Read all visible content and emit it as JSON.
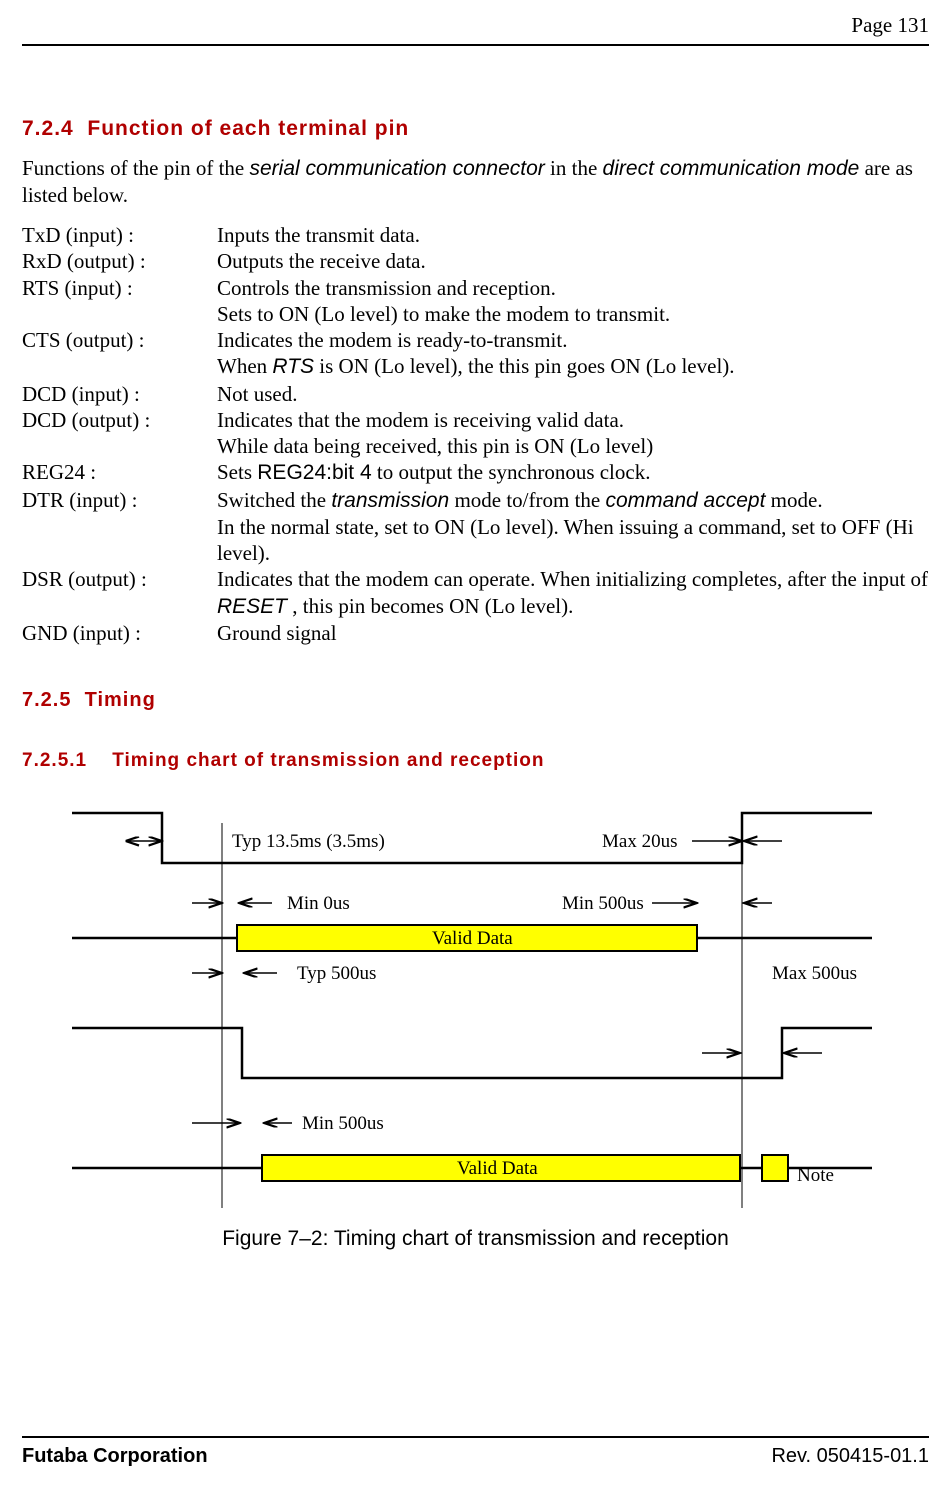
{
  "header": {
    "page_label": "Page  131"
  },
  "h724": {
    "num": "7.2.4",
    "title": "Function of each terminal pin"
  },
  "intro": {
    "pre": "Functions of the pin of the ",
    "em1": "serial communication connector",
    "mid": " in the ",
    "em2": "direct communication mode",
    "post": " are as listed below."
  },
  "pins": {
    "txd": {
      "label": "TxD (input) :",
      "l1": "Inputs the transmit data."
    },
    "rxd": {
      "label": "RxD (output) :",
      "l1": "Outputs the receive data."
    },
    "rts": {
      "label": "RTS (input) :",
      "l1": "Controls the transmission and reception.",
      "l2": "Sets to ON (Lo level) to make the modem to transmit."
    },
    "cts": {
      "label": "CTS (output) :",
      "l1": "Indicates the modem is ready-to-transmit.",
      "l2a": "When ",
      "l2em": "RTS",
      "l2b": " is ON (Lo level), the this pin goes ON (Lo level)."
    },
    "dcd_in": {
      "label": "DCD (input) :",
      "l1": "Not used."
    },
    "dcd_out": {
      "label": "DCD (output) :",
      "l1": "Indicates that the modem is receiving valid data.",
      "l2": "While data being received, this pin is ON (Lo level)"
    },
    "reg24": {
      "label": "REG24 :",
      "l1a": "Sets ",
      "l1reg": "REG24:bit 4",
      "l1b": " to output the synchronous clock."
    },
    "dtr": {
      "label": "DTR (input) :",
      "l1a": "Switched the ",
      "l1em1": "transmission",
      "l1b": " mode to/from the ",
      "l1em2": "command accept",
      "l1c": " mode.",
      "l2": "In the normal state, set to ON (Lo level). When issuing a command, set to OFF (Hi level)."
    },
    "dsr": {
      "label": "DSR (output) :",
      "l1a": "Indicates that the modem can operate. When initializing completes, after the input of ",
      "l1em": "RESET",
      "l1b": ", this pin becomes ON (Lo level)."
    },
    "gnd": {
      "label": "GND (input) :",
      "l1": "Ground signal"
    }
  },
  "h725": {
    "num": "7.2.5",
    "title": "Timing"
  },
  "h7251": {
    "num": "7.2.5.1",
    "title": "Timing chart of transmission and reception"
  },
  "timing": {
    "typ135": "Typ 13.5ms (3.5ms)",
    "max20": "Max  20us",
    "min0": "Min 0us",
    "min500a": "Min 500us",
    "valid1": "Valid Data",
    "typ500": "Typ 500us",
    "max500": "Max  500us",
    "min500b": "Min 500us",
    "valid2": "Valid Data",
    "note": "Note"
  },
  "caption": "Figure 7–2:  Timing chart of transmission and reception",
  "footer": {
    "left": "Futaba Corporation",
    "right": "Rev. 050415-01.1"
  },
  "chart_data": {
    "type": "timing-diagram",
    "title": "Timing chart of transmission and reception",
    "signals": [
      {
        "name": "signal-1",
        "annotations": [
          {
            "label": "Typ 13.5ms (3.5ms)",
            "from": "falling-edge-1",
            "to": "rising-edge-1-data"
          },
          {
            "label": "Max 20us",
            "from": "rising-edge-1-data",
            "to": "rising-edge-1"
          }
        ]
      },
      {
        "name": "signal-2-tx-data",
        "annotations": [
          {
            "label": "Min 0us",
            "from": "signal-1-fall",
            "to": "valid-data-start"
          },
          {
            "label": "Min 500us",
            "from": "valid-data-end",
            "to": "signal-1-rise"
          }
        ],
        "valid_region": "Valid Data"
      },
      {
        "name": "signal-3",
        "annotations": [
          {
            "label": "Typ 500us",
            "from": "signal-1-fall",
            "to": "falling-edge-3"
          },
          {
            "label": "Max 500us",
            "from": "signal-1-rise-approx",
            "to": "rising-edge-3"
          }
        ]
      },
      {
        "name": "signal-4-rx-data",
        "annotations": [
          {
            "label": "Min 500us",
            "from": "signal-3-fall",
            "to": "valid-data-start"
          }
        ],
        "valid_region": "Valid Data",
        "note": "Note (small yellow marker after signal-1 rise)"
      }
    ]
  }
}
